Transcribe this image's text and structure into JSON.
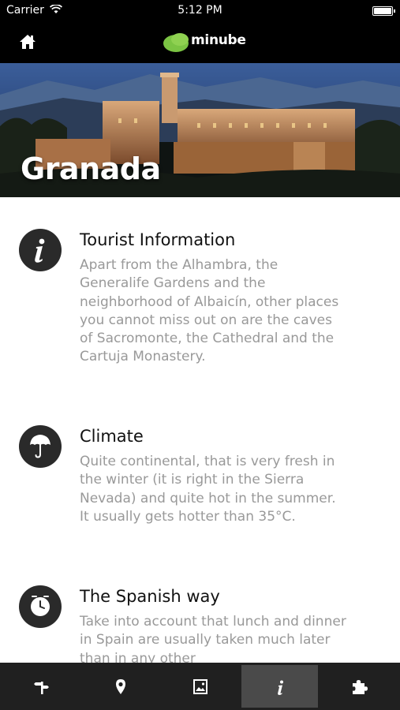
{
  "status_bar": {
    "carrier": "Carrier",
    "time": "5:12 PM"
  },
  "nav": {
    "home_icon": "home-icon",
    "logo_text": "minube",
    "logo_color": "#7bc443"
  },
  "hero": {
    "title": "Granada"
  },
  "sections": [
    {
      "icon": "info-icon",
      "title": "Tourist Information",
      "body": "Apart from the Alhambra, the Generalife Gardens and the neighborhood of Albaicín, other places you cannot miss out on are the caves of Sacromonte, the Cathedral and the Cartuja Monastery."
    },
    {
      "icon": "umbrella-icon",
      "title": "Climate",
      "body": "Quite continental, that is very fresh in the winter (it is right in the Sierra Nevada) and quite hot in the summer. It usually gets hotter than 35°C."
    },
    {
      "icon": "clock-icon",
      "title": "The Spanish way",
      "body": "Take into account that lunch and dinner in Spain are usually taken much later than in any other"
    }
  ],
  "tabs": [
    {
      "icon": "signpost-icon",
      "active": false
    },
    {
      "icon": "location-pin-icon",
      "active": false
    },
    {
      "icon": "photo-icon",
      "active": false
    },
    {
      "icon": "info-icon",
      "active": true
    },
    {
      "icon": "puzzle-icon",
      "active": false
    }
  ]
}
